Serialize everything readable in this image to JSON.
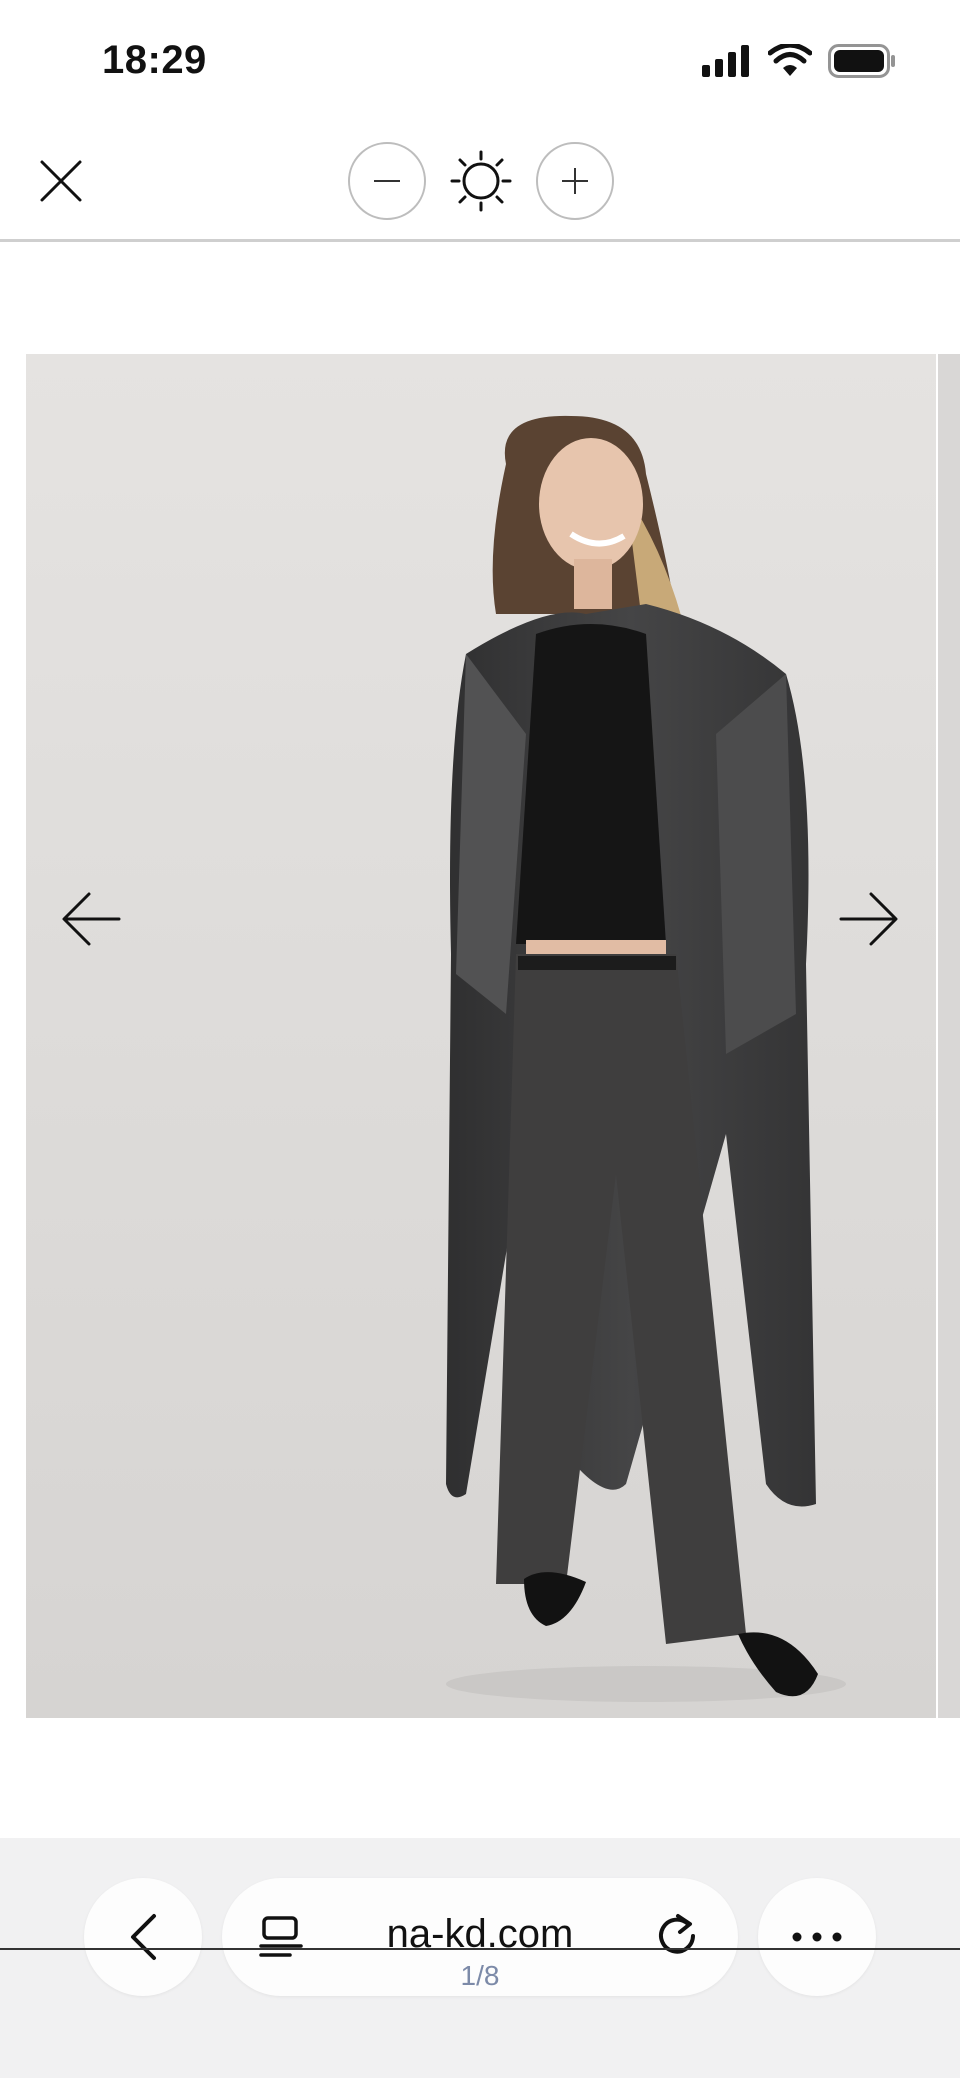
{
  "status_bar": {
    "time": "18:29",
    "icons": [
      "signal-icon",
      "wifi-icon",
      "battery-icon"
    ]
  },
  "viewer_toolbar": {
    "close_icon": "close-icon",
    "zoom_out_icon": "minus-icon",
    "brightness_icon": "sun-icon",
    "zoom_in_icon": "plus-icon"
  },
  "gallery": {
    "image_alt": "Model wearing long dark grey denim coat, black top and grey wide-leg jeans",
    "prev_icon": "arrow-left-icon",
    "next_icon": "arrow-right-icon",
    "page_indicator": "1/8",
    "current_index": 1,
    "total_images": 8
  },
  "browser_bar": {
    "url": "na-kd.com",
    "back_icon": "chevron-left-icon",
    "reader_icon": "reader-icon",
    "reload_icon": "reload-icon",
    "more_icon": "more-icon"
  },
  "colors": {
    "background": "#ffffff",
    "photo_bg": "#dedcda",
    "coat": "#3b3b3c",
    "jeans": "#3e3d3d",
    "browser_bar": "#f1f1f2",
    "page_indicator": "#7c8aa8"
  }
}
